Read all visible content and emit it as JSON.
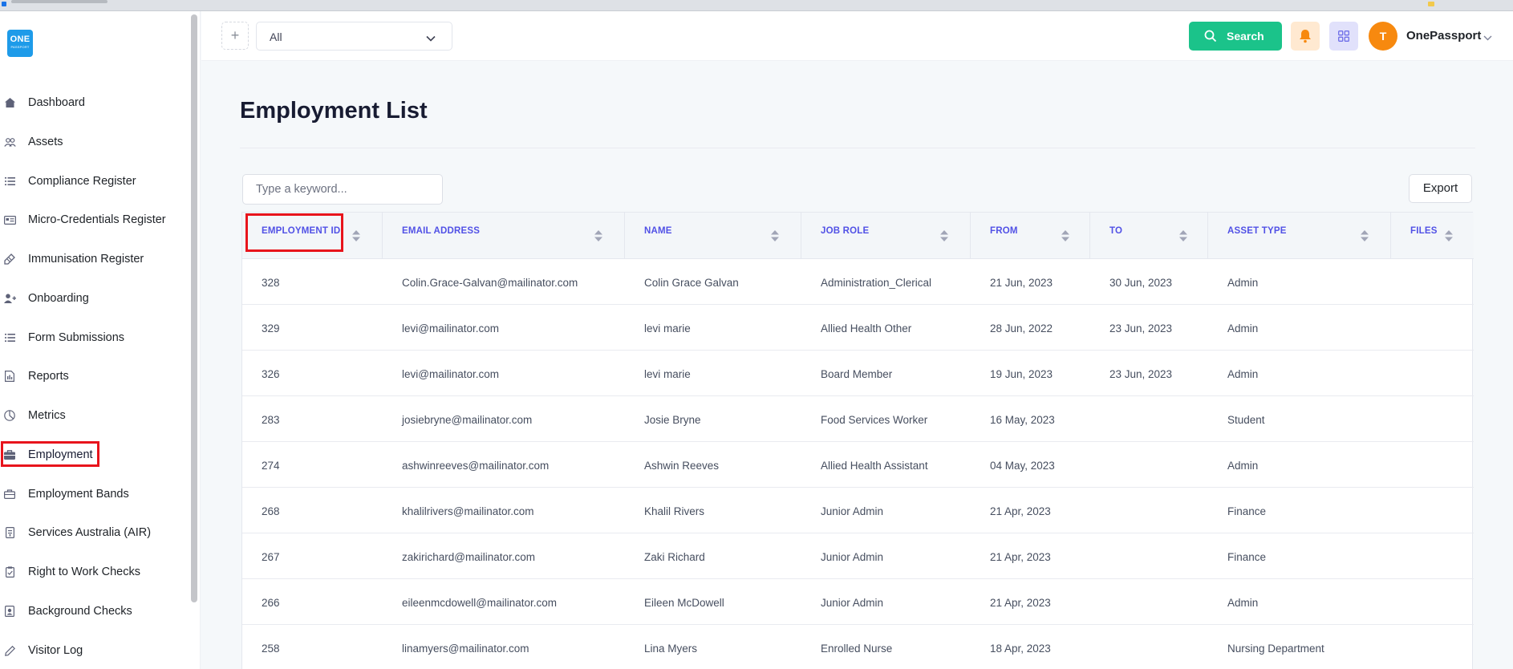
{
  "app": {
    "logo_line1": "ONE",
    "logo_line2": "PASSPORT",
    "accent_color": "#5151e6",
    "success_color": "#1bc38a",
    "highlight_color": "#e8141c"
  },
  "sidebar": {
    "items": [
      {
        "label": "Dashboard",
        "icon": "home-icon"
      },
      {
        "label": "Assets",
        "icon": "users-icon"
      },
      {
        "label": "Compliance Register",
        "icon": "list-icon"
      },
      {
        "label": "Micro-Credentials Register",
        "icon": "id-card-icon"
      },
      {
        "label": "Immunisation Register",
        "icon": "syringe-icon"
      },
      {
        "label": "Onboarding",
        "icon": "user-plus-icon"
      },
      {
        "label": "Form Submissions",
        "icon": "list-icon"
      },
      {
        "label": "Reports",
        "icon": "report-icon"
      },
      {
        "label": "Metrics",
        "icon": "pie-chart-icon"
      },
      {
        "label": "Employment",
        "icon": "briefcase-icon"
      },
      {
        "label": "Employment Bands",
        "icon": "briefcase-outline-icon"
      },
      {
        "label": "Services Australia (AIR)",
        "icon": "document-icon"
      },
      {
        "label": "Right to Work Checks",
        "icon": "clipboard-check-icon"
      },
      {
        "label": "Background Checks",
        "icon": "shield-icon"
      },
      {
        "label": "Visitor Log",
        "icon": "pencil-icon"
      }
    ],
    "active": "Employment"
  },
  "header": {
    "filter_value": "All",
    "search_label": "Search",
    "avatar_initial": "T",
    "user_name": "OnePassport"
  },
  "main": {
    "title": "Employment List",
    "search_placeholder": "Type a keyword...",
    "export_label": "Export",
    "columns": [
      "EMPLOYMENT ID",
      "EMAIL ADDRESS",
      "NAME",
      "JOB ROLE",
      "FROM",
      "TO",
      "ASSET TYPE",
      "FILES"
    ],
    "rows": [
      {
        "id": "328",
        "email": "Colin.Grace-Galvan@mailinator.com",
        "name": "Colin Grace Galvan",
        "role": "Administration_Clerical",
        "from": "21 Jun, 2023",
        "to": "30 Jun, 2023",
        "asset": "Admin",
        "files": ""
      },
      {
        "id": "329",
        "email": "levi@mailinator.com",
        "name": "levi marie",
        "role": "Allied Health Other",
        "from": "28 Jun, 2022",
        "to": "23 Jun, 2023",
        "asset": "Admin",
        "files": ""
      },
      {
        "id": "326",
        "email": "levi@mailinator.com",
        "name": "levi marie",
        "role": "Board Member",
        "from": "19 Jun, 2023",
        "to": "23 Jun, 2023",
        "asset": "Admin",
        "files": ""
      },
      {
        "id": "283",
        "email": "josiebryne@mailinator.com",
        "name": "Josie Bryne",
        "role": "Food Services Worker",
        "from": "16 May, 2023",
        "to": "",
        "asset": "Student",
        "files": ""
      },
      {
        "id": "274",
        "email": "ashwinreeves@mailinator.com",
        "name": "Ashwin Reeves",
        "role": "Allied Health Assistant",
        "from": "04 May, 2023",
        "to": "",
        "asset": "Admin",
        "files": ""
      },
      {
        "id": "268",
        "email": "khalilrivers@mailinator.com",
        "name": "Khalil Rivers",
        "role": "Junior Admin",
        "from": "21 Apr, 2023",
        "to": "",
        "asset": "Finance",
        "files": ""
      },
      {
        "id": "267",
        "email": "zakirichard@mailinator.com",
        "name": "Zaki Richard",
        "role": "Junior Admin",
        "from": "21 Apr, 2023",
        "to": "",
        "asset": "Finance",
        "files": ""
      },
      {
        "id": "266",
        "email": "eileenmcdowell@mailinator.com",
        "name": "Eileen McDowell",
        "role": "Junior Admin",
        "from": "21 Apr, 2023",
        "to": "",
        "asset": "Admin",
        "files": ""
      },
      {
        "id": "258",
        "email": "linamyers@mailinator.com",
        "name": "Lina Myers",
        "role": "Enrolled Nurse",
        "from": "18 Apr, 2023",
        "to": "",
        "asset": "Nursing Department",
        "files": ""
      }
    ]
  }
}
